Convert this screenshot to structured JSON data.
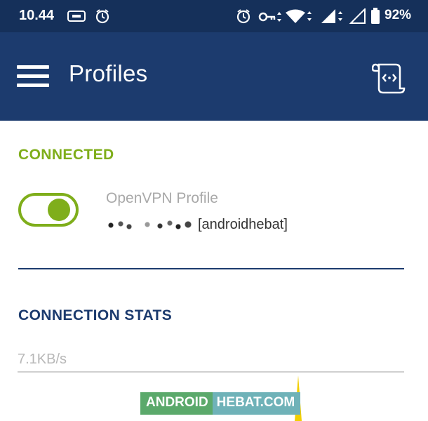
{
  "status_bar": {
    "time": "10.44",
    "battery_percent": "92%",
    "icons": [
      "cast-icon",
      "alarm-icon",
      "alarm-icon",
      "vpn-key-icon",
      "wifi-icon",
      "signal-icon",
      "signal-empty-icon",
      "battery-icon"
    ]
  },
  "toolbar": {
    "title": "Profiles",
    "menu_icon": "hamburger-menu-icon",
    "import_icon": "import-profile-icon"
  },
  "connected_section": {
    "header": "CONNECTED",
    "profile": {
      "name": "OpenVPN Profile",
      "server_suffix": "[androidhebat]",
      "toggle_on": true
    }
  },
  "stats_section": {
    "header": "CONNECTION STATS",
    "speed": "7.1KB/s"
  },
  "watermark": {
    "part1": "ANDROID",
    "part2": "HEBAT.COM"
  },
  "colors": {
    "status_bar": "#15305a",
    "toolbar": "#1c3b6e",
    "connected_green": "#7fae1b",
    "graph_yellow": "#f2cf00"
  }
}
